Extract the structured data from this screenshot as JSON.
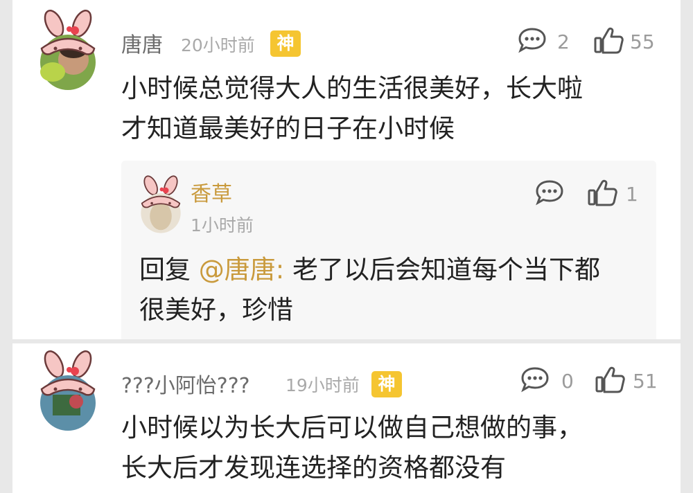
{
  "comments": [
    {
      "username": "唐唐",
      "time": "20小时前",
      "badge": "神",
      "comment_count": "2",
      "like_count": "55",
      "text_line1": "小时候总觉得大人的生活很美好，长大啦",
      "text_line2": "才知道最美好的日子在小时候",
      "reply": {
        "username": "香草",
        "time": "1小时前",
        "like_count": "1",
        "prefix": "回复 ",
        "mention": "@唐唐:",
        "text_line1": " 老了以后会知道每个当下都",
        "text_line2": "很美好，珍惜"
      }
    },
    {
      "username": "???小阿怡???",
      "time": "19小时前",
      "badge": "神",
      "comment_count": "0",
      "like_count": "51",
      "text_line1": "小时候以为长大后可以做自己想做的事，",
      "text_line2": "长大后才发现连选择的资格都没有"
    }
  ],
  "colors": {
    "badge": "#f5c531",
    "mention": "#c99a3c",
    "avatar_pink": "#f6c6c4"
  },
  "icons": [
    "speech-bubble-icon",
    "thumbs-up-icon",
    "bunny-avatar-frame-icon"
  ]
}
